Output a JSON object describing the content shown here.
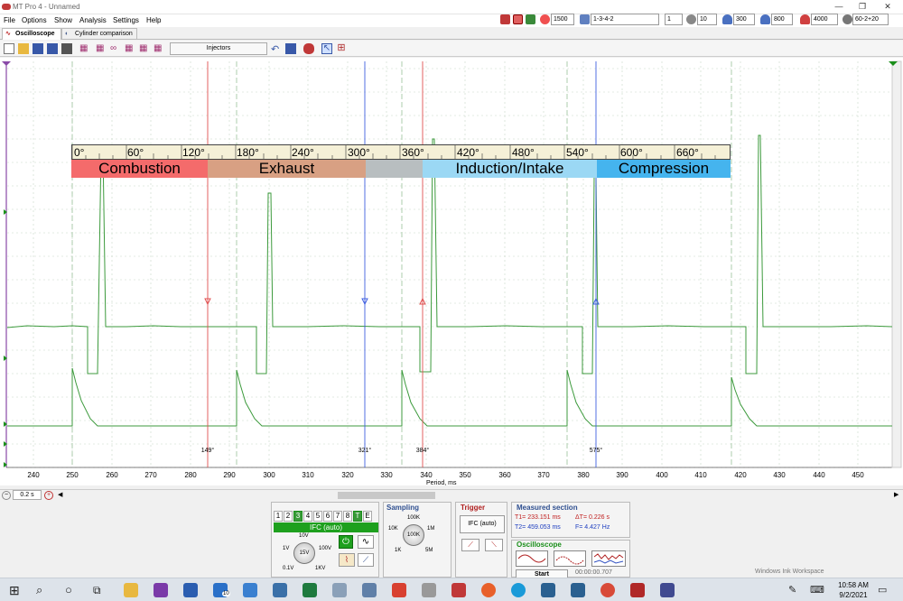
{
  "window": {
    "title": "MT Pro 4 - Unnamed"
  },
  "menu": [
    "File",
    "Options",
    "Show",
    "Analysis",
    "Settings",
    "Help"
  ],
  "topbar": {
    "values": [
      "1500",
      "1-3-4-2",
      "1",
      "10",
      "300",
      "800",
      "4000",
      "60-2+20"
    ]
  },
  "tabs": [
    {
      "label": "Oscilloscope"
    },
    {
      "label": "Cylinder comparison"
    }
  ],
  "toolbar": {
    "injectors_label": "Injectors"
  },
  "overlay": {
    "degrees": [
      "0°",
      "60°",
      "120°",
      "180°",
      "240°",
      "300°",
      "360°",
      "420°",
      "480°",
      "540°",
      "600°",
      "660°"
    ],
    "phases": [
      {
        "label": "Combustion",
        "color": "#f46b6b"
      },
      {
        "label": "Exhaust",
        "color": "#d8a083"
      },
      {
        "label": "",
        "color": "#b8bec0"
      },
      {
        "label": "Induction/Intake",
        "color": "#9bd8f4"
      },
      {
        "label": "Compression",
        "color": "#45b4ee"
      }
    ]
  },
  "axis": {
    "x_ticks": [
      "240",
      "250",
      "260",
      "270",
      "280",
      "290",
      "300",
      "310",
      "320",
      "330",
      "340",
      "350",
      "360",
      "370",
      "380",
      "390",
      "400",
      "410",
      "420",
      "430",
      "440",
      "450"
    ],
    "x_label": "Period, ms"
  },
  "cursors": [
    {
      "label": "149°",
      "color": "#e05050"
    },
    {
      "label": "321°",
      "color": "#4060e0"
    },
    {
      "label": "384°",
      "color": "#e05050"
    },
    {
      "label": "575°",
      "color": "#4060e0"
    }
  ],
  "scroll": {
    "timebase": "0.2 s"
  },
  "channels": {
    "numbers": [
      "1",
      "2",
      "3",
      "4",
      "5",
      "6",
      "7",
      "8",
      "T",
      "E"
    ],
    "mode_label": "IFC (auto)",
    "knob_labels": [
      "10V",
      "1V",
      "100V",
      "0.1V",
      "1KV"
    ],
    "knob_value": "15V"
  },
  "sampling": {
    "title": "Sampling",
    "labels": [
      "100K",
      "10K",
      "1M",
      "1K",
      "5M"
    ],
    "knob_value": "100K"
  },
  "trigger": {
    "title": "Trigger",
    "mode": "IFC (auto)"
  },
  "measured": {
    "title": "Measured section",
    "t1": "T1= 233.151 ms",
    "t2": "T2= 459.053 ms",
    "dt": "ΔT= 0.226 s",
    "f": "F= 4.427 Hz"
  },
  "oscilloscope": {
    "title": "Oscilloscope",
    "start": "Start",
    "elapsed": "00:00:00.707"
  },
  "watermark": "Windows Ink Workspace",
  "taskbar": {
    "time": "10:58 AM",
    "date": "9/2/2021",
    "badge": "10"
  },
  "colors": {
    "signal": "#3c9a3c",
    "accent": "#1a8f1a"
  }
}
